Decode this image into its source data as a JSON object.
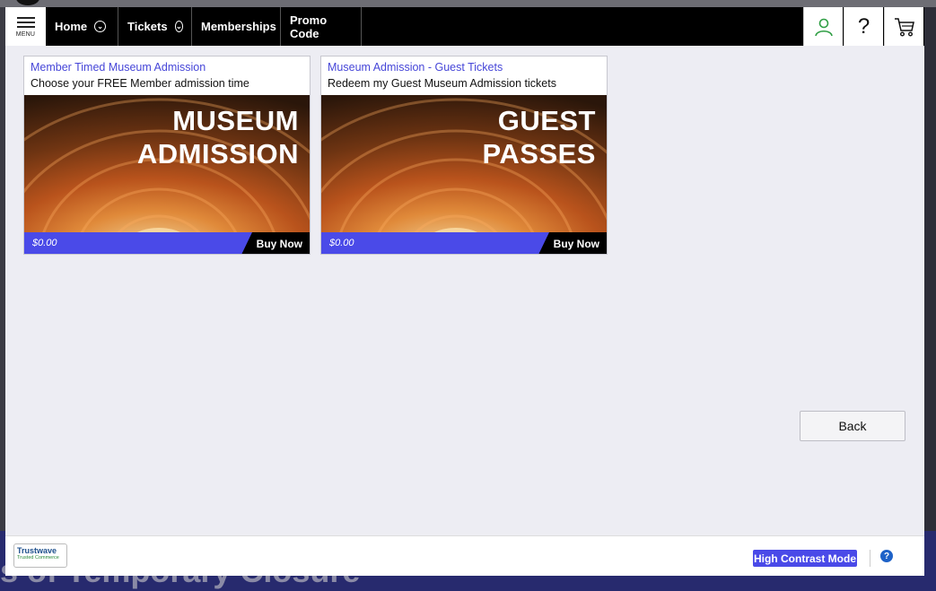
{
  "background": {
    "heading_fragment": "s of Temporary Closure"
  },
  "topbar": {
    "menu_label": "MENU",
    "nav": [
      {
        "label": "Home",
        "has_dropdown": true
      },
      {
        "label": "Tickets",
        "has_dropdown": true
      },
      {
        "label": "Memberships",
        "has_dropdown": false
      },
      {
        "label": "Promo Code",
        "has_dropdown": false
      }
    ],
    "icons": [
      "user-icon",
      "help-icon",
      "cart-icon"
    ],
    "help_glyph": "?"
  },
  "cards": [
    {
      "title": "Member Timed Museum Admission",
      "subtitle": "Choose your FREE Member admission time",
      "image_line1": "MUSEUM",
      "image_line2": "ADMISSION",
      "price": "$0.00",
      "buy_label": "Buy Now"
    },
    {
      "title": "Museum Admission - Guest Tickets",
      "subtitle": "Redeem my Guest Museum Admission tickets",
      "image_line1": "GUEST",
      "image_line2": "PASSES",
      "price": "$0.00",
      "buy_label": "Buy Now"
    }
  ],
  "back_label": "Back",
  "footer": {
    "trust_name": "Trustwave",
    "trust_sub": "Trusted Commerce",
    "high_contrast_label": "High Contrast Mode",
    "help_glyph": "?"
  },
  "colors": {
    "accent": "#4a4ae8",
    "link": "#4646d8",
    "topbar": "#000000",
    "panel": "#ededf3"
  }
}
